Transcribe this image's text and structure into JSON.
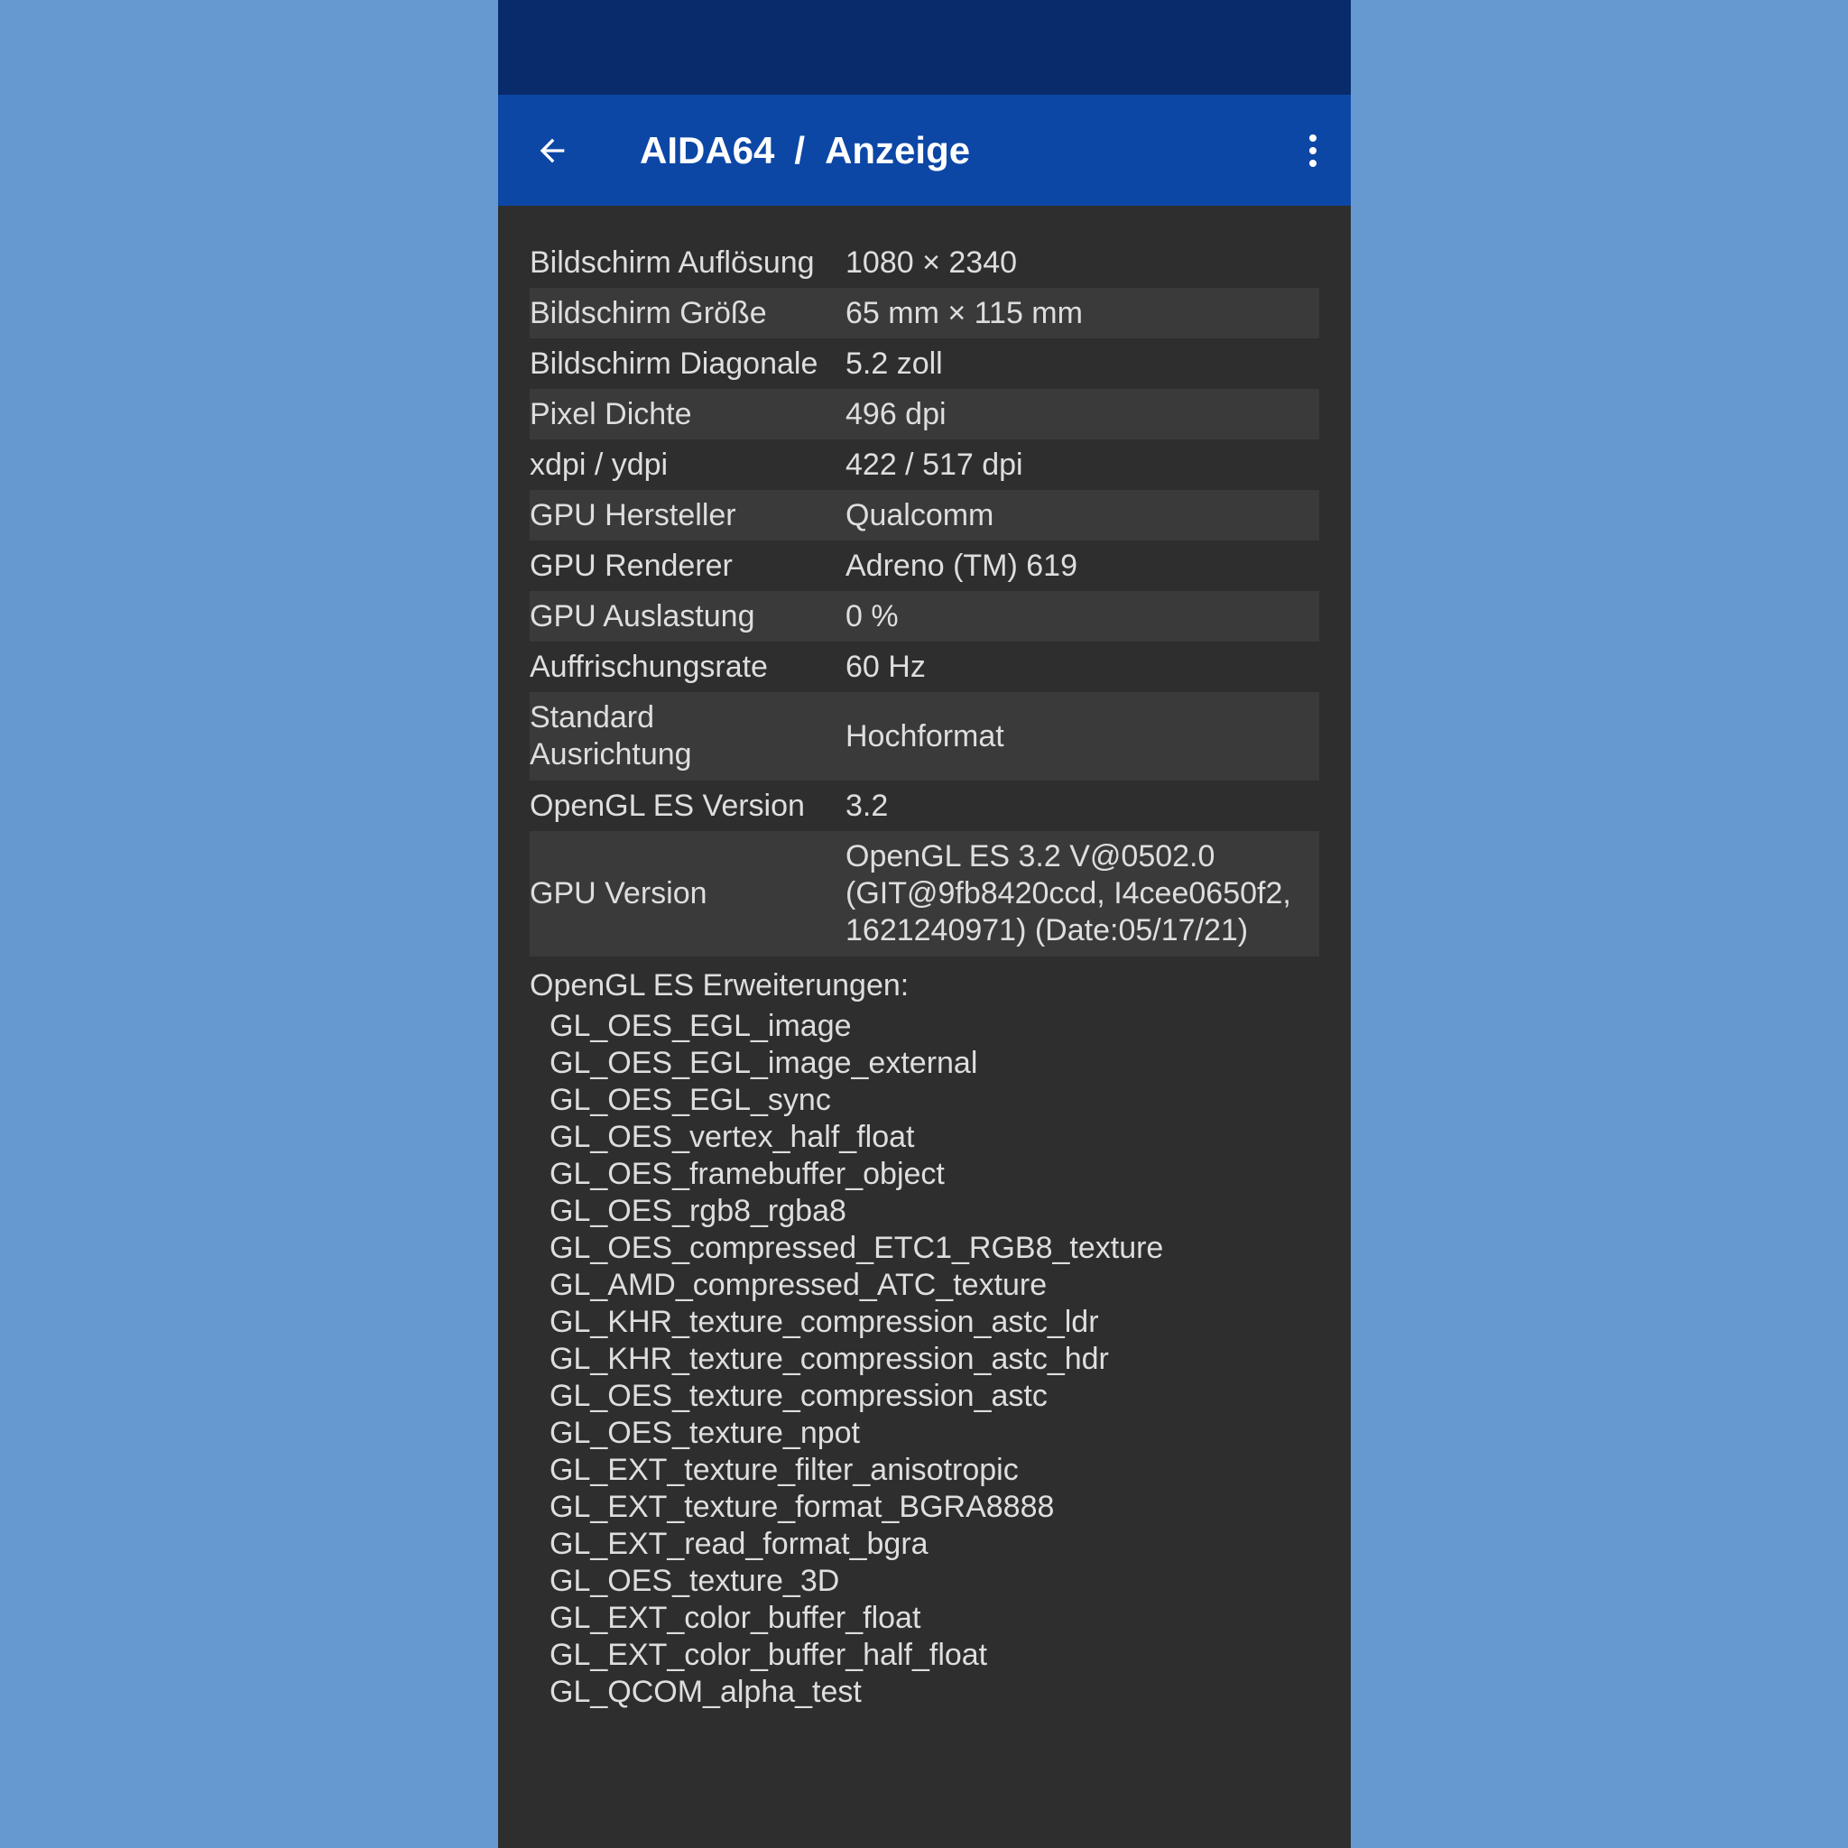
{
  "header": {
    "app": "AIDA64",
    "separator": "/",
    "page": "Anzeige"
  },
  "icons": {
    "back": "arrow-left-icon",
    "menu": "more-vertical-icon"
  },
  "colors": {
    "background": "#6699cf",
    "statusbar": "#072b6b",
    "appbar": "#0c47a6",
    "content_bg": "#2e2e2e",
    "row_alt": "#3a3a3a",
    "text": "#dedede"
  },
  "rows": [
    {
      "label": "Bildschirm Auflösung",
      "value": "1080 × 2340"
    },
    {
      "label": "Bildschirm Größe",
      "value": "65 mm × 115 mm"
    },
    {
      "label": "Bildschirm Diagonale",
      "value": "5.2 zoll"
    },
    {
      "label": "Pixel Dichte",
      "value": "496 dpi"
    },
    {
      "label": "xdpi / ydpi",
      "value": "422 / 517 dpi"
    },
    {
      "label": "GPU Hersteller",
      "value": "Qualcomm"
    },
    {
      "label": "GPU Renderer",
      "value": "Adreno (TM) 619"
    },
    {
      "label": "GPU Auslastung",
      "value": "0 %"
    },
    {
      "label": "Auffrischungsrate",
      "value": "60 Hz"
    },
    {
      "label": "Standard Ausrichtung",
      "value": "Hochformat"
    },
    {
      "label": "OpenGL ES Version",
      "value": "3.2"
    },
    {
      "label": "GPU Version",
      "value": "OpenGL ES 3.2 V@0502.0 (GIT@9fb8420ccd, I4cee0650f2, 1621240971) (Date:05/17/21)"
    }
  ],
  "extensions_header": "OpenGL ES Erweiterungen:",
  "extensions": [
    "GL_OES_EGL_image",
    "GL_OES_EGL_image_external",
    "GL_OES_EGL_sync",
    "GL_OES_vertex_half_float",
    "GL_OES_framebuffer_object",
    "GL_OES_rgb8_rgba8",
    "GL_OES_compressed_ETC1_RGB8_texture",
    "GL_AMD_compressed_ATC_texture",
    "GL_KHR_texture_compression_astc_ldr",
    "GL_KHR_texture_compression_astc_hdr",
    "GL_OES_texture_compression_astc",
    "GL_OES_texture_npot",
    "GL_EXT_texture_filter_anisotropic",
    "GL_EXT_texture_format_BGRA8888",
    "GL_EXT_read_format_bgra",
    "GL_OES_texture_3D",
    "GL_EXT_color_buffer_float",
    "GL_EXT_color_buffer_half_float",
    "GL_QCOM_alpha_test"
  ]
}
